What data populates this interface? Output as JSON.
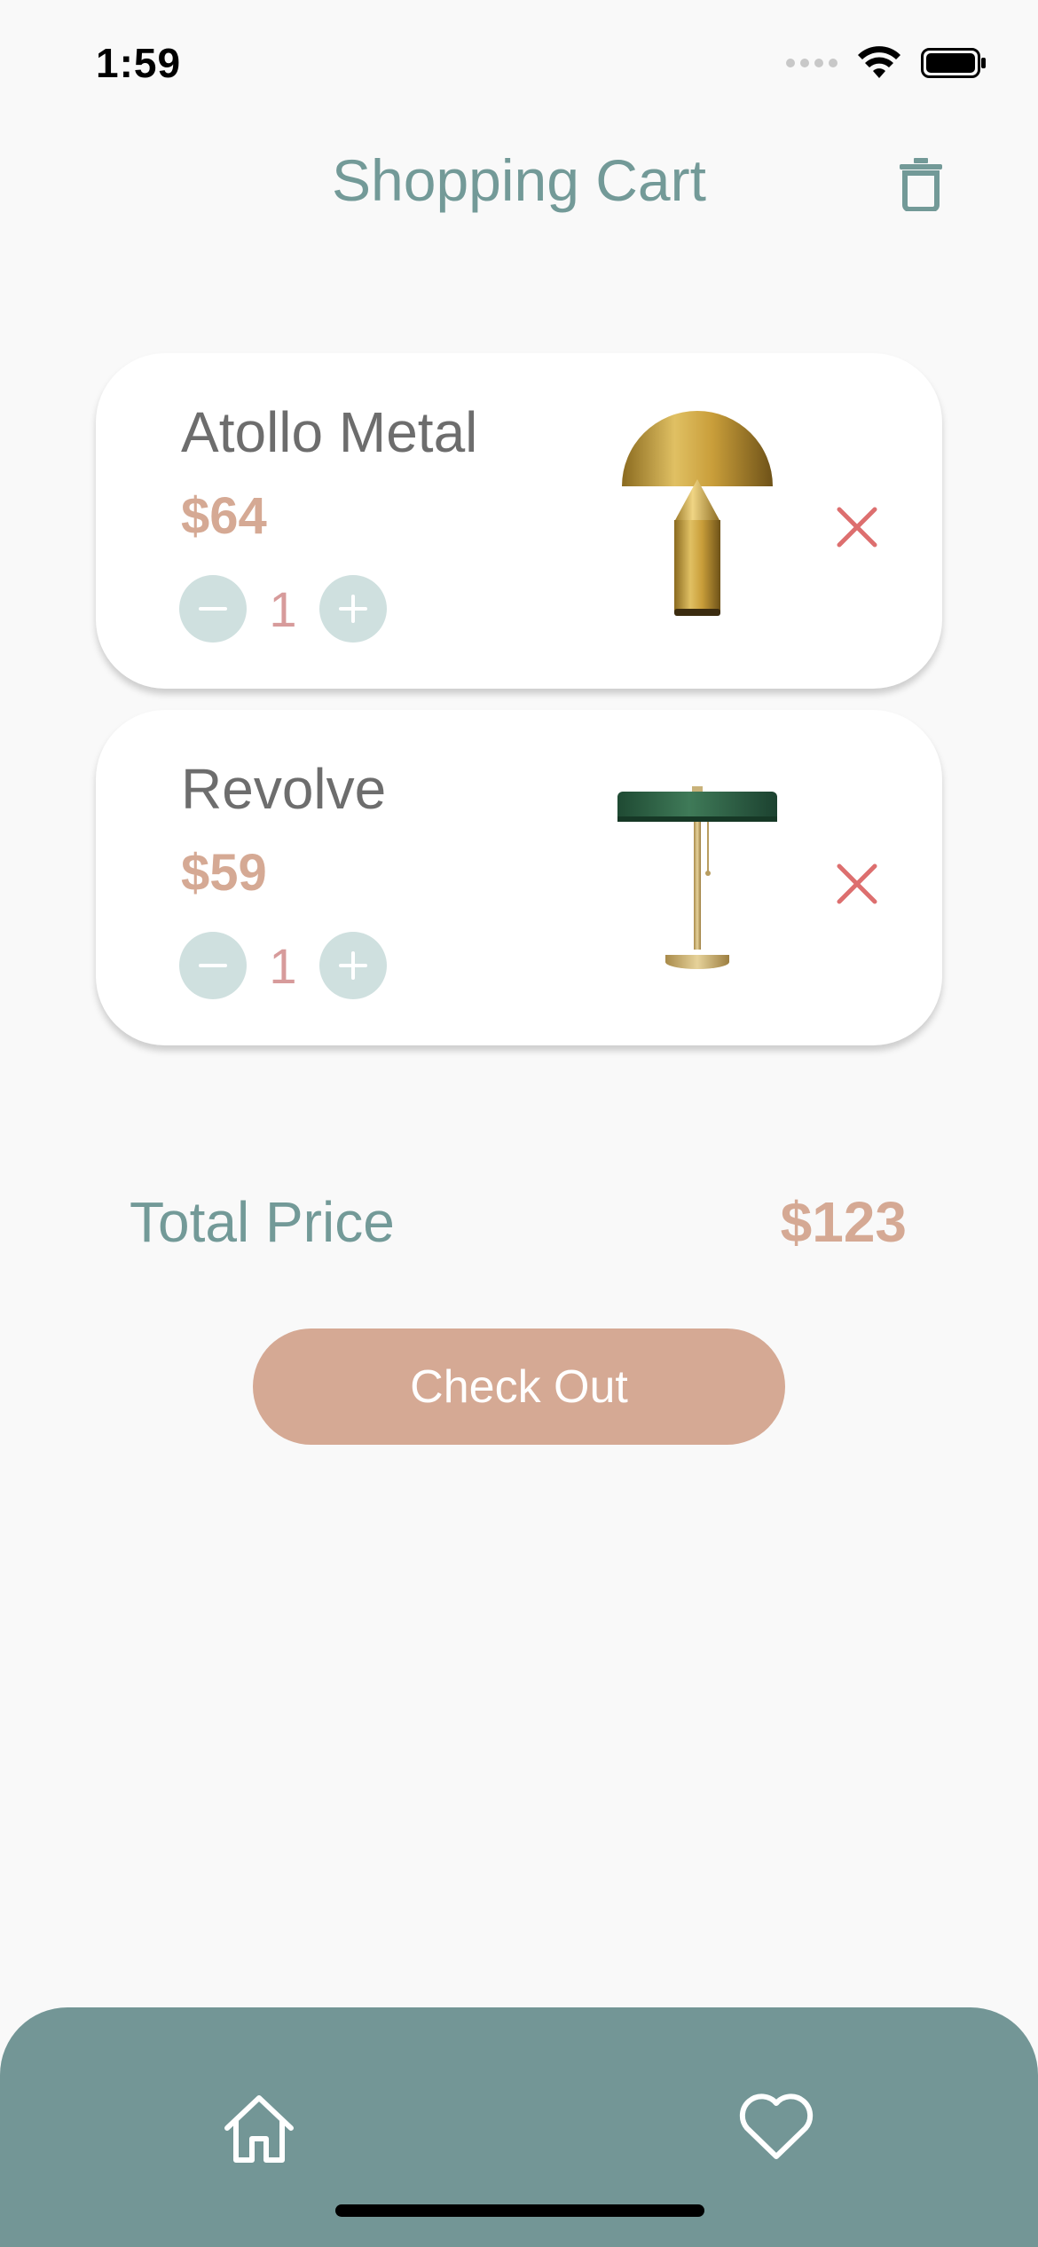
{
  "status_bar": {
    "time": "1:59"
  },
  "header": {
    "title": "Shopping Cart",
    "trash_icon": "trash-icon"
  },
  "cart": {
    "items": [
      {
        "name": "Atollo Metal",
        "price": "$64",
        "quantity": "1",
        "image": "gold-mushroom-lamp"
      },
      {
        "name": "Revolve",
        "price": "$59",
        "quantity": "1",
        "image": "green-shade-table-lamp"
      }
    ]
  },
  "summary": {
    "total_label": "Total Price",
    "total_value": "$123"
  },
  "checkout": {
    "label": "Check Out"
  },
  "bottom_nav": {
    "home_icon": "home-icon",
    "favorites_icon": "heart-icon"
  },
  "colors": {
    "accent_teal": "#739a98",
    "price_peach": "#d5a994",
    "remove_red": "#dd6f6f",
    "qty_button_bg": "#cfe0df",
    "nav_bg": "#739696",
    "background": "#f9f9f9"
  }
}
